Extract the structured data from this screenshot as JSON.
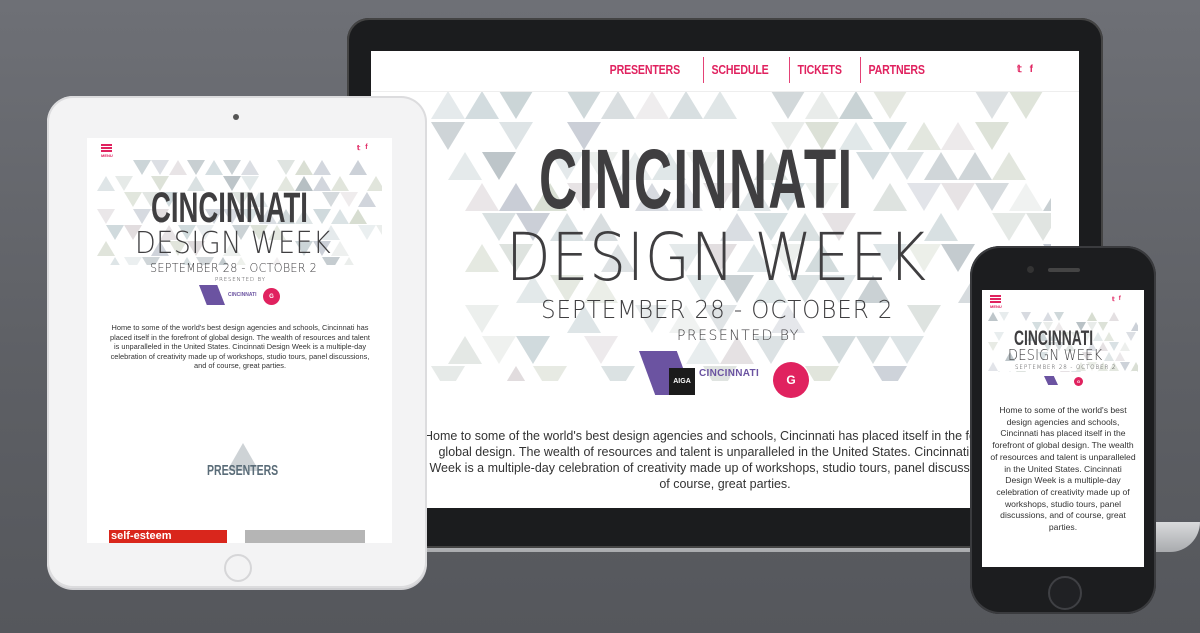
{
  "colors": {
    "accent": "#e0225f",
    "title": "#3f3e40",
    "aiga_purple": "#6b53a1"
  },
  "site": {
    "nav": [
      "PRESENTERS",
      "SCHEDULE",
      "TICKETS",
      "PARTNERS"
    ],
    "social": {
      "twitter": "𝕥",
      "facebook": "f"
    },
    "title_line1": "CINCINNATI",
    "title_line2": "DESIGN WEEK",
    "dates": "SEPTEMBER 28 - OCTOBER 2",
    "presented_by": "PRESENTED BY",
    "aiga_mark": "AIGA",
    "aiga_city": "CINCINNATI",
    "g_logo": "G",
    "menu_label": "MENU",
    "intro": "Home to some of the world's best design agencies and schools, Cincinnati has placed itself in the forefront of global design. The wealth of resources and talent is unparalleled in the United States. Cincinnati Design Week is a multiple-day celebration of creativity made up of workshops, studio tours, panel discussions, and of course, great parties.",
    "laptop_intro": "Home to some of the world's best design agencies and schools, Cincinnati has placed itself in the forefront of global design. The wealth of resources and talent is unparalleled in the United States. Cincinnati Design Week is a multiple-day celebration of creativity made up of workshops, studio tours, panel discussions, and of course, great parties.",
    "presenters_heading": "PRESENTERS",
    "presenter_tile": "self-esteem"
  }
}
